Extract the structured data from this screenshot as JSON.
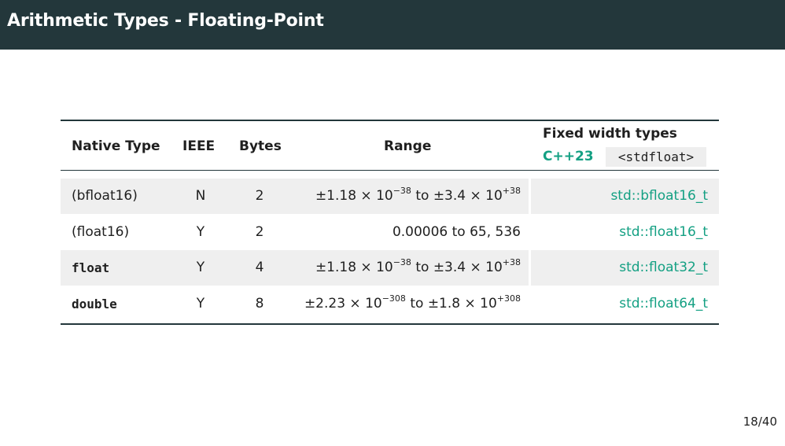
{
  "slide": {
    "title": "Arithmetic Types - Floating-Point",
    "page": "18/40"
  },
  "table": {
    "headers": {
      "native_type": "Native Type",
      "ieee": "IEEE",
      "bytes": "Bytes",
      "range": "Range",
      "fixed_width": "Fixed width types",
      "cpp_version": "C++23",
      "header_file": "<stdfloat>"
    },
    "rows": [
      {
        "type": "(bfloat16)",
        "ieee": "N",
        "bytes": "2",
        "range_min_mant": "±1.18 × 10",
        "range_min_exp": "−38",
        "range_to": " to ",
        "range_max_mant": "±3.4 × 10",
        "range_max_exp": "+38",
        "fixed": "std::bfloat16_t"
      },
      {
        "type": "(float16)",
        "ieee": "Y",
        "bytes": "2",
        "range_text": "0.00006 to 65, 536",
        "fixed": "std::float16_t"
      },
      {
        "type": "float",
        "ieee": "Y",
        "bytes": "4",
        "range_min_mant": "±1.18 × 10",
        "range_min_exp": "−38",
        "range_to": " to ",
        "range_max_mant": "±3.4 × 10",
        "range_max_exp": "+38",
        "fixed": "std::float32_t"
      },
      {
        "type": "double",
        "ieee": "Y",
        "bytes": "8",
        "range_min_mant": "±2.23 × 10",
        "range_min_exp": "−308",
        "range_to": " to ",
        "range_max_mant": "±1.8 × 10",
        "range_max_exp": "+308",
        "fixed": "std::float64_t"
      }
    ]
  },
  "colors": {
    "title_bar": "#23373b",
    "accent": "#14a083",
    "row_shade": "#efefef"
  }
}
